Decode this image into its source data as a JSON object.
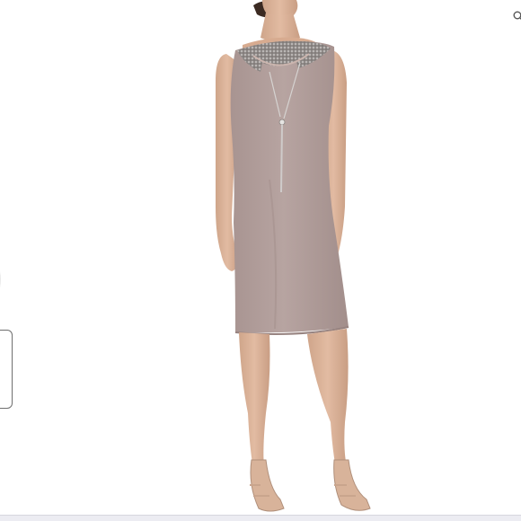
{
  "viewer": {
    "background": "#ffffff",
    "dress_color": "#b29f9c",
    "skin_color": "#dcb49a"
  },
  "icons": {
    "zoom": "magnifier-icon",
    "previous": "chevron-left-icon"
  }
}
